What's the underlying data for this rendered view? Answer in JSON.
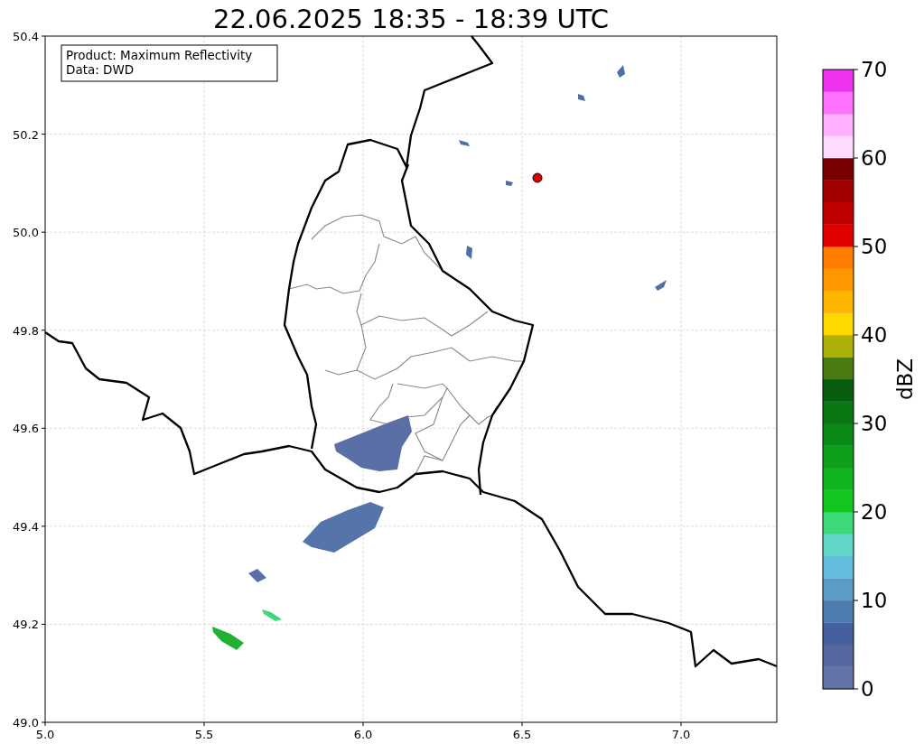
{
  "title": "22.06.2025 18:35 - 18:39 UTC",
  "info_box": [
    "Product: Maximum Reflectivity",
    "Data: DWD"
  ],
  "x_axis": {
    "ticks": [
      "5.0",
      "5.5",
      "6.0",
      "6.5",
      "7.0"
    ]
  },
  "y_axis": {
    "ticks": [
      "50.4",
      "50.2",
      "50.0",
      "49.8",
      "49.6",
      "49.4",
      "49.2",
      "49.0"
    ]
  },
  "colorbar": {
    "label": "dBZ",
    "ticks": [
      "70",
      "60",
      "50",
      "40",
      "30",
      "20",
      "10",
      "0"
    ],
    "segments": [
      {
        "color": "#6373a8"
      },
      {
        "color": "#56689f"
      },
      {
        "color": "#4460a0"
      },
      {
        "color": "#4e7cb0"
      },
      {
        "color": "#5b9cc6"
      },
      {
        "color": "#63bcdb"
      },
      {
        "color": "#62d6c8"
      },
      {
        "color": "#3dd878"
      },
      {
        "color": "#12c81e"
      },
      {
        "color": "#10b41c"
      },
      {
        "color": "#0ea01a"
      },
      {
        "color": "#0a8a16"
      },
      {
        "color": "#0a7614"
      },
      {
        "color": "#085e10"
      },
      {
        "color": "#4a7a10"
      },
      {
        "color": "#aeb00a"
      },
      {
        "color": "#ffd800"
      },
      {
        "color": "#ffb400"
      },
      {
        "color": "#ff9800"
      },
      {
        "color": "#ff7c00"
      },
      {
        "color": "#e00000"
      },
      {
        "color": "#c00000"
      },
      {
        "color": "#a00000"
      },
      {
        "color": "#780000"
      },
      {
        "color": "#ffdcff"
      },
      {
        "color": "#ffb0ff"
      },
      {
        "color": "#ff70ff"
      },
      {
        "color": "#ee33ee"
      }
    ]
  }
}
